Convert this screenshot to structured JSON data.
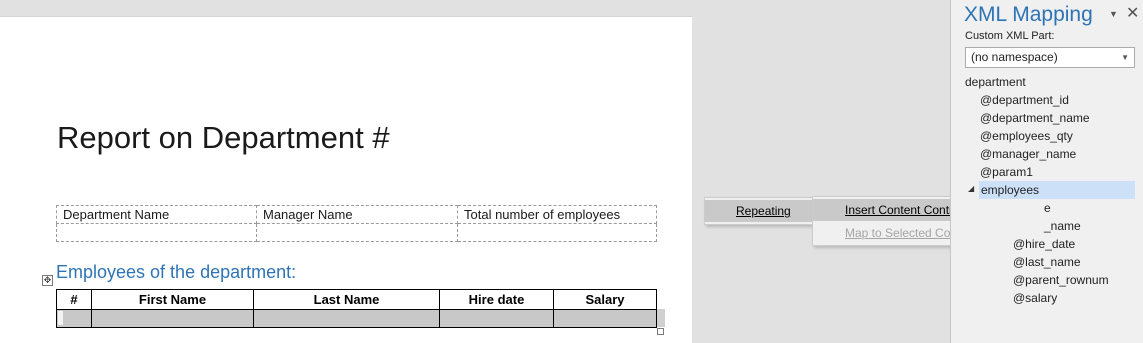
{
  "document": {
    "title": "Report on Department #",
    "info_table": {
      "headers": [
        "Department Name",
        "Manager Name",
        "Total number of employees"
      ]
    },
    "section_heading": "Employees of the department:",
    "employees_table": {
      "headers": [
        "#",
        "First Name",
        "Last Name",
        "Hire date",
        "Salary"
      ]
    }
  },
  "context_menu": {
    "item": "Repeating"
  },
  "submenu": {
    "items": [
      {
        "label": "Insert Content Control",
        "enabled": true,
        "has_submenu": true
      },
      {
        "label": "Map to Selected Content Control",
        "enabled": false
      }
    ]
  },
  "xml_pane": {
    "title": "XML Mapping",
    "custom_part_label": "Custom XML Part:",
    "custom_part_value": "(no namespace)",
    "tree": {
      "root": "department",
      "attributes": [
        "@department_id",
        "@department_name",
        "@employees_qty",
        "@manager_name",
        "@param1"
      ],
      "selected": "employees",
      "children_visible": [
        "e",
        "_name",
        "@hire_date",
        "@last_name",
        "@parent_rownum",
        "@salary"
      ]
    }
  },
  "colors": {
    "accent": "#2e74b5",
    "selection": "#cce0f7",
    "menu_highlight": "#c9c9c9"
  }
}
